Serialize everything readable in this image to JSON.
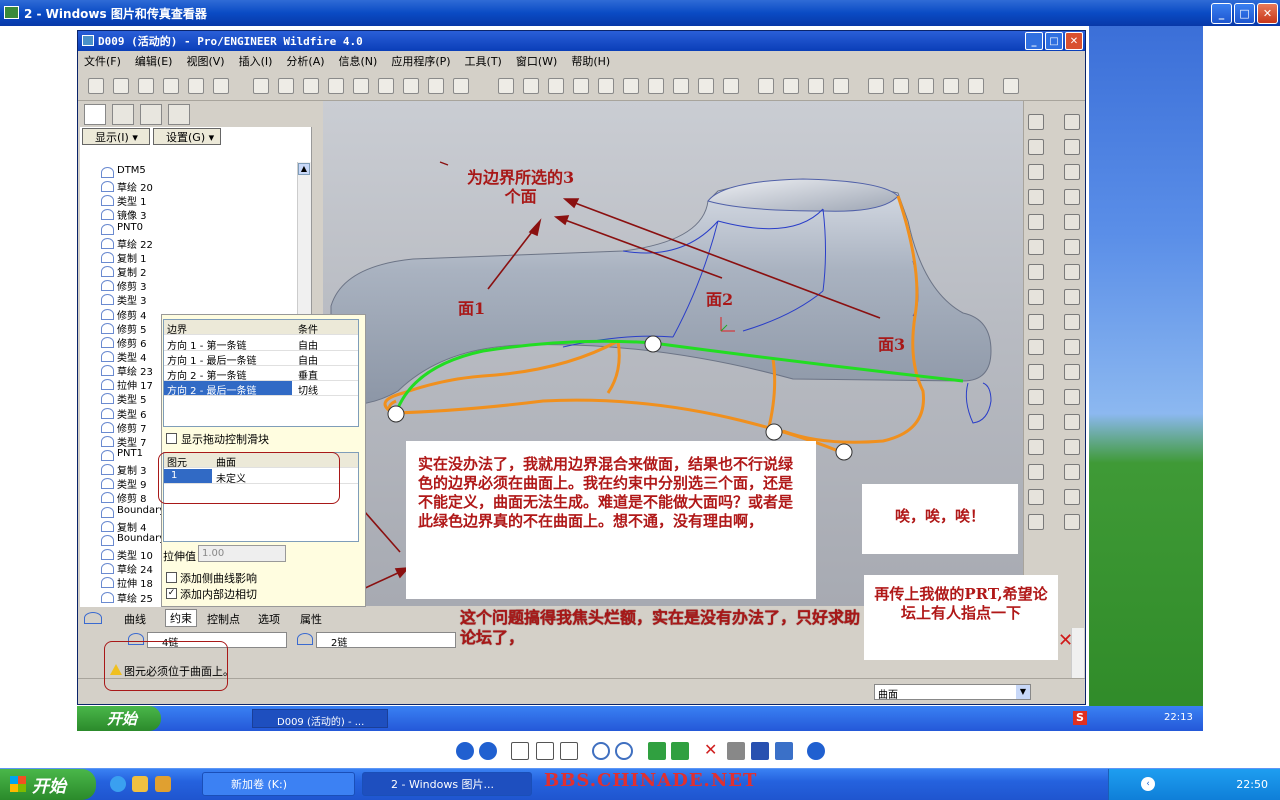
{
  "viewer": {
    "title": "2 - Windows 图片和传真查看器",
    "controls": {
      "minimize": "_",
      "maximize": "□",
      "close": "✕"
    }
  },
  "proe": {
    "title": "D009 (活动的) - Pro/ENGINEER Wildfire 4.0",
    "menu": [
      "文件(F)",
      "编辑(E)",
      "视图(V)",
      "插入(I)",
      "分析(A)",
      "信息(N)",
      "应用程序(P)",
      "工具(T)",
      "窗口(W)",
      "帮助(H)"
    ],
    "tree": {
      "show_label": "显示(I) ▾",
      "settings_label": "设置(G) ▾",
      "items": [
        "DTM5",
        "草绘 20",
        "类型 1",
        "镜像 3",
        "PNT0",
        "草绘 22",
        "复制 1",
        "复制 2",
        "修剪 3",
        "类型 3",
        "修剪 4",
        "修剪 5",
        "修剪 6",
        "类型 4",
        "草绘 23",
        "拉伸 17",
        "类型 5",
        "类型 6",
        "修剪 7",
        "类型 7",
        "PNT1",
        "复制 3",
        "类型 9",
        "修剪 8",
        "Boundary",
        "复制 4",
        "Boundary",
        "类型 10",
        "草绘 24",
        "拉伸 18",
        "草绘 25"
      ]
    },
    "dialog": {
      "boundary_header": "边界",
      "condition_header": "条件",
      "rows": [
        {
          "boundary": "方向 1 - 第一条链",
          "condition": "自由"
        },
        {
          "boundary": "方向 1 - 最后一条链",
          "condition": "自由"
        },
        {
          "boundary": "方向 2 - 第一条链",
          "condition": "垂直"
        },
        {
          "boundary": "方向 2 - 最后一条链",
          "condition": "切线"
        }
      ],
      "show_drag_handles": "显示拖动控制滑块",
      "element_header": "图元",
      "surface_header": "曲面",
      "element_row": {
        "id": "1",
        "surface": "未定义"
      },
      "stretch_label": "拉伸值",
      "stretch_value": "1.00",
      "add_side_curve": "添加侧曲线影响",
      "add_inner_tangent": "添加内部边相切"
    },
    "bottom_tabs": [
      "曲线",
      "约束",
      "控制点",
      "选项",
      "属性"
    ],
    "chain1": "4链",
    "chain2": "2链",
    "warning": "图元必须位于曲面上。",
    "filter": "曲面",
    "inner_taskbar": {
      "start": "开始",
      "task": "D009 (活动的) - ...",
      "clock": "22:13"
    }
  },
  "annotations": {
    "surfaces_title": "为边界所选的3\n个面",
    "face1": "面1",
    "face2": "面2",
    "face3": "面3",
    "main_note": "实在没办法了，我就用边界混合来做面，结果也不行说绿色的边界必须在曲面上。我在约束中分别选三个面，还是不能定义，曲面无法生成。难道是不能做大面吗？或者是此绿色边界真的不在曲面上。想不通，没有理由啊，",
    "sigh": "唉，唉，唉！",
    "prt_note": "再传上我做的PRT,希望论坛上有人指点一下",
    "help_note": "这个问题搞得我焦头烂额，实在是没有办法了，只好求助论坛了，"
  },
  "taskbar": {
    "start": "开始",
    "tasks": [
      "新加卷 (K:)",
      "2 - Windows 图片..."
    ],
    "watermark": "BBS.CHINADE.NET",
    "clock": "22:50"
  },
  "colors": {
    "green_chain": "#22dd22",
    "orange_curves": "#f0901e",
    "annotation_red": "#a81818"
  }
}
